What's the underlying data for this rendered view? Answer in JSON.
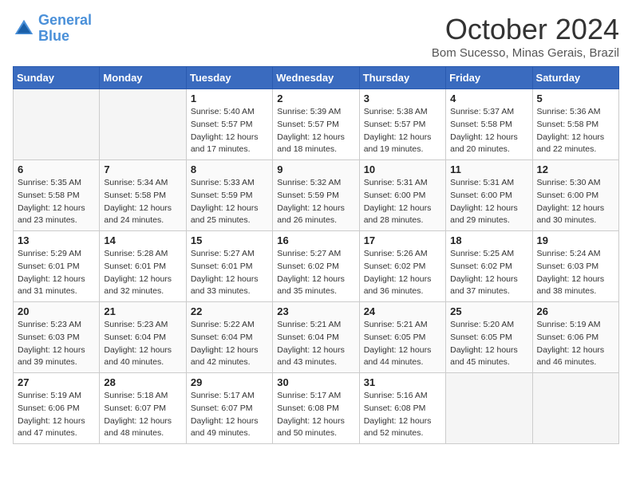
{
  "logo": {
    "line1": "General",
    "line2": "Blue"
  },
  "title": "October 2024",
  "location": "Bom Sucesso, Minas Gerais, Brazil",
  "days_of_week": [
    "Sunday",
    "Monday",
    "Tuesday",
    "Wednesday",
    "Thursday",
    "Friday",
    "Saturday"
  ],
  "weeks": [
    [
      {
        "day": "",
        "empty": true
      },
      {
        "day": "",
        "empty": true
      },
      {
        "day": "1",
        "sunrise": "5:40 AM",
        "sunset": "5:57 PM",
        "daylight": "12 hours and 17 minutes."
      },
      {
        "day": "2",
        "sunrise": "5:39 AM",
        "sunset": "5:57 PM",
        "daylight": "12 hours and 18 minutes."
      },
      {
        "day": "3",
        "sunrise": "5:38 AM",
        "sunset": "5:57 PM",
        "daylight": "12 hours and 19 minutes."
      },
      {
        "day": "4",
        "sunrise": "5:37 AM",
        "sunset": "5:58 PM",
        "daylight": "12 hours and 20 minutes."
      },
      {
        "day": "5",
        "sunrise": "5:36 AM",
        "sunset": "5:58 PM",
        "daylight": "12 hours and 22 minutes."
      }
    ],
    [
      {
        "day": "6",
        "sunrise": "5:35 AM",
        "sunset": "5:58 PM",
        "daylight": "12 hours and 23 minutes."
      },
      {
        "day": "7",
        "sunrise": "5:34 AM",
        "sunset": "5:58 PM",
        "daylight": "12 hours and 24 minutes."
      },
      {
        "day": "8",
        "sunrise": "5:33 AM",
        "sunset": "5:59 PM",
        "daylight": "12 hours and 25 minutes."
      },
      {
        "day": "9",
        "sunrise": "5:32 AM",
        "sunset": "5:59 PM",
        "daylight": "12 hours and 26 minutes."
      },
      {
        "day": "10",
        "sunrise": "5:31 AM",
        "sunset": "6:00 PM",
        "daylight": "12 hours and 28 minutes."
      },
      {
        "day": "11",
        "sunrise": "5:31 AM",
        "sunset": "6:00 PM",
        "daylight": "12 hours and 29 minutes."
      },
      {
        "day": "12",
        "sunrise": "5:30 AM",
        "sunset": "6:00 PM",
        "daylight": "12 hours and 30 minutes."
      }
    ],
    [
      {
        "day": "13",
        "sunrise": "5:29 AM",
        "sunset": "6:01 PM",
        "daylight": "12 hours and 31 minutes."
      },
      {
        "day": "14",
        "sunrise": "5:28 AM",
        "sunset": "6:01 PM",
        "daylight": "12 hours and 32 minutes."
      },
      {
        "day": "15",
        "sunrise": "5:27 AM",
        "sunset": "6:01 PM",
        "daylight": "12 hours and 33 minutes."
      },
      {
        "day": "16",
        "sunrise": "5:27 AM",
        "sunset": "6:02 PM",
        "daylight": "12 hours and 35 minutes."
      },
      {
        "day": "17",
        "sunrise": "5:26 AM",
        "sunset": "6:02 PM",
        "daylight": "12 hours and 36 minutes."
      },
      {
        "day": "18",
        "sunrise": "5:25 AM",
        "sunset": "6:02 PM",
        "daylight": "12 hours and 37 minutes."
      },
      {
        "day": "19",
        "sunrise": "5:24 AM",
        "sunset": "6:03 PM",
        "daylight": "12 hours and 38 minutes."
      }
    ],
    [
      {
        "day": "20",
        "sunrise": "5:23 AM",
        "sunset": "6:03 PM",
        "daylight": "12 hours and 39 minutes."
      },
      {
        "day": "21",
        "sunrise": "5:23 AM",
        "sunset": "6:04 PM",
        "daylight": "12 hours and 40 minutes."
      },
      {
        "day": "22",
        "sunrise": "5:22 AM",
        "sunset": "6:04 PM",
        "daylight": "12 hours and 42 minutes."
      },
      {
        "day": "23",
        "sunrise": "5:21 AM",
        "sunset": "6:04 PM",
        "daylight": "12 hours and 43 minutes."
      },
      {
        "day": "24",
        "sunrise": "5:21 AM",
        "sunset": "6:05 PM",
        "daylight": "12 hours and 44 minutes."
      },
      {
        "day": "25",
        "sunrise": "5:20 AM",
        "sunset": "6:05 PM",
        "daylight": "12 hours and 45 minutes."
      },
      {
        "day": "26",
        "sunrise": "5:19 AM",
        "sunset": "6:06 PM",
        "daylight": "12 hours and 46 minutes."
      }
    ],
    [
      {
        "day": "27",
        "sunrise": "5:19 AM",
        "sunset": "6:06 PM",
        "daylight": "12 hours and 47 minutes."
      },
      {
        "day": "28",
        "sunrise": "5:18 AM",
        "sunset": "6:07 PM",
        "daylight": "12 hours and 48 minutes."
      },
      {
        "day": "29",
        "sunrise": "5:17 AM",
        "sunset": "6:07 PM",
        "daylight": "12 hours and 49 minutes."
      },
      {
        "day": "30",
        "sunrise": "5:17 AM",
        "sunset": "6:08 PM",
        "daylight": "12 hours and 50 minutes."
      },
      {
        "day": "31",
        "sunrise": "5:16 AM",
        "sunset": "6:08 PM",
        "daylight": "12 hours and 52 minutes."
      },
      {
        "day": "",
        "empty": true
      },
      {
        "day": "",
        "empty": true
      }
    ]
  ],
  "labels": {
    "sunrise": "Sunrise:",
    "sunset": "Sunset:",
    "daylight": "Daylight:"
  }
}
